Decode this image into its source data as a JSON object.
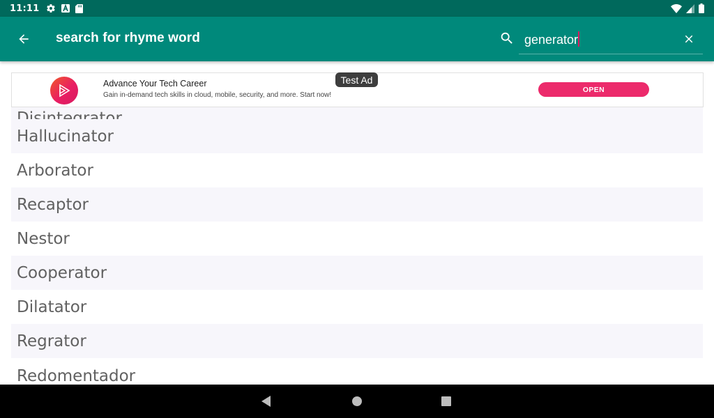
{
  "status_bar": {
    "time": "11:11",
    "left_icons": [
      "settings-icon",
      "a-badge-icon",
      "sd-card-icon"
    ],
    "right_icons": [
      "wifi-icon",
      "signal-icon",
      "battery-icon"
    ]
  },
  "app_bar": {
    "title": "search for rhyme word",
    "search_value": "generator",
    "colors": {
      "primary": "#00897b",
      "primary_dark": "#00695c",
      "accent": "#d81b60"
    }
  },
  "ad": {
    "badge": "Test Ad",
    "title": "Advance Your Tech Career",
    "description": "Gain in-demand tech skills in cloud, mobile, security, and more. Start now!",
    "cta": "OPEN",
    "cta_color": "#ec2a6b"
  },
  "results": {
    "items": [
      "Disintegrator",
      "Hallucinator",
      "Arborator",
      "Recaptor",
      "Nestor",
      "Cooperator",
      "Dilatator",
      "Regrator",
      "Redomentador"
    ]
  },
  "nav_bar": {
    "icons": [
      "back-triangle-icon",
      "home-circle-icon",
      "recents-square-icon"
    ]
  }
}
